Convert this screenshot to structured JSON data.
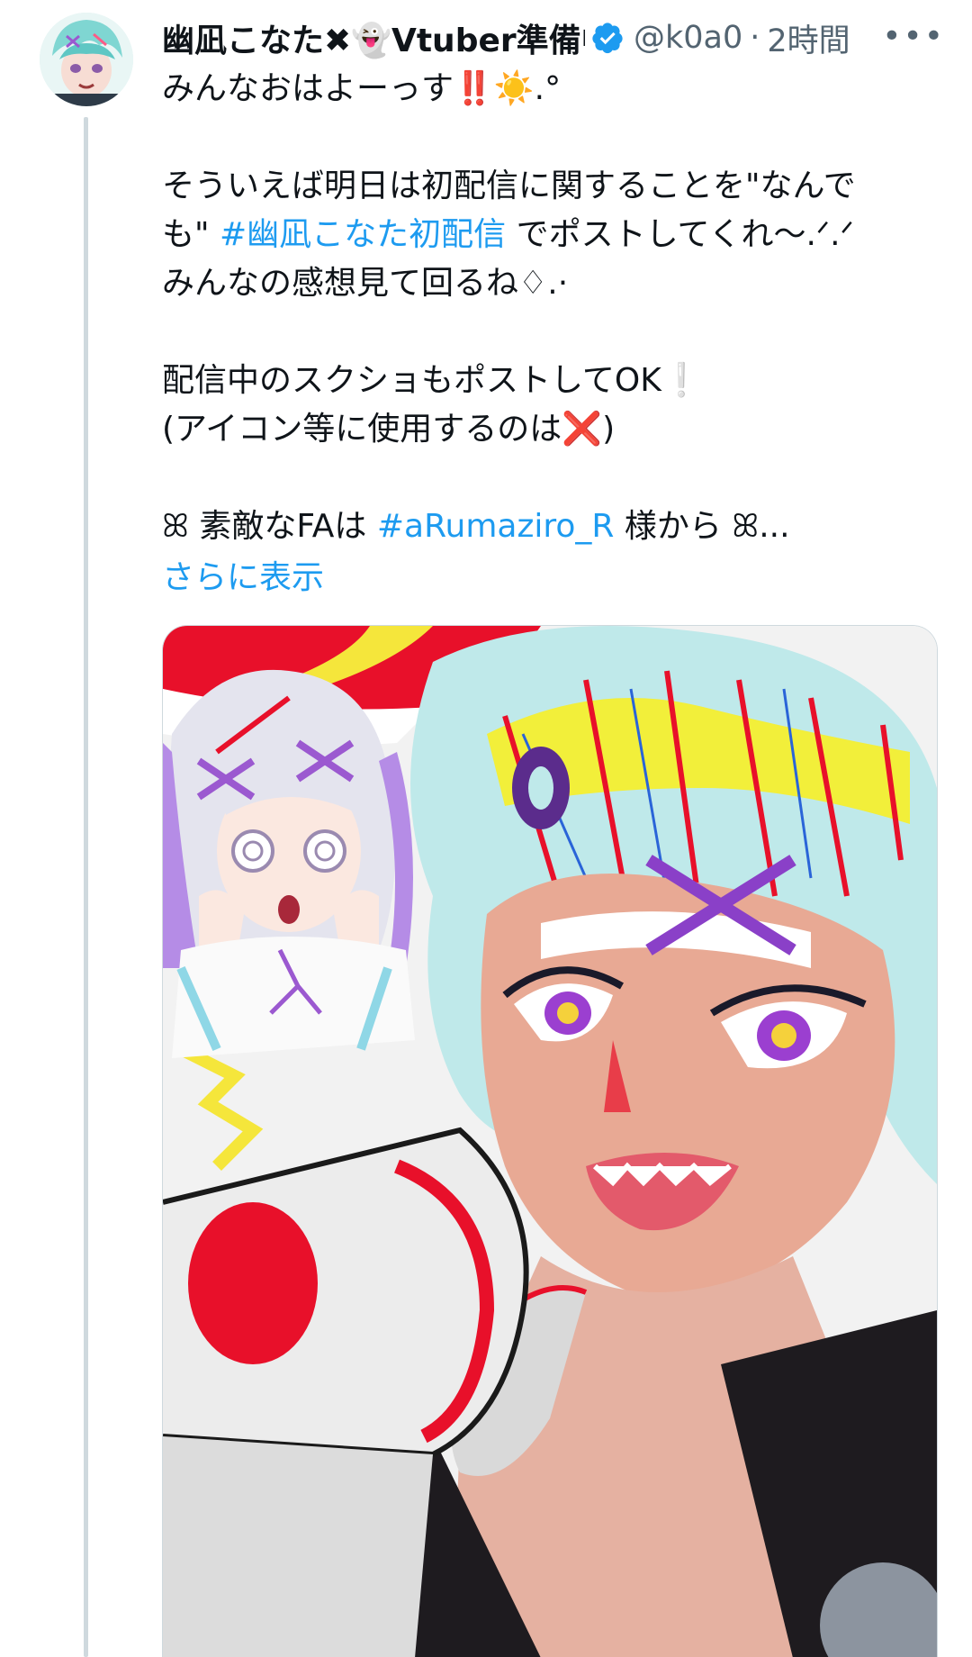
{
  "tweet": {
    "display_name": "幽凪こなた✖👻Vtuber準備中",
    "handle": "@k0a0",
    "separator": "·",
    "time": "2時間",
    "more_label": "•••",
    "lines": [
      [
        "みんなおはよーっす",
        "‼️",
        "☀️",
        ".°"
      ],
      [
        "そういえば明日は初配信に関することを\"なんで"
      ],
      [
        "も\" ",
        "#幽凪こなた初配信",
        " でポストしてくれ〜.ᐟ.ᐟ"
      ],
      [
        "みんなの感想見て回るね",
        "♢.·"
      ],
      [
        "配信中のスクショもポストしてOK",
        "❕"
      ],
      [
        "(アイコン等に使用するのは",
        "❌",
        ")"
      ],
      [
        "ꕤ 素敵なFAは ",
        "#aRumaziro_R",
        " 様から ꕤ..."
      ]
    ],
    "show_more": "さらに表示"
  },
  "icons": {
    "verified": "verified-badge-icon",
    "more": "more-options-icon"
  },
  "colors": {
    "link": "#1d9bf0",
    "secondary_text": "#536471",
    "thread_line": "#cfd9de",
    "verified": "#1d9bf0"
  }
}
